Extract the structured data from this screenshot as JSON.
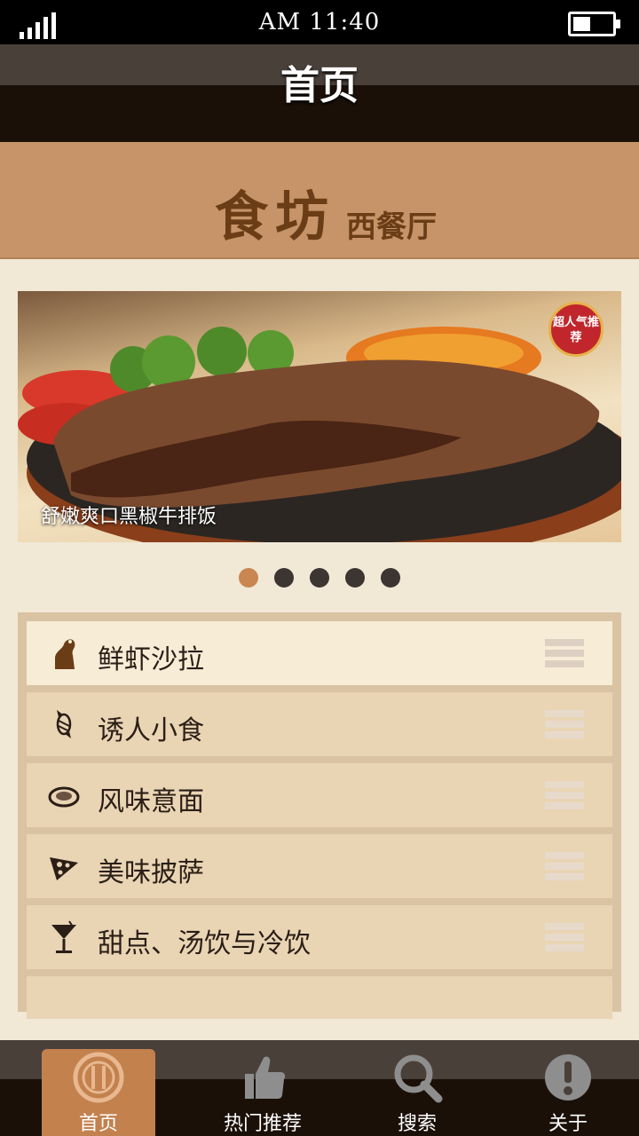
{
  "status_bar": {
    "time": "AM 11:40",
    "battery_level": 0.45,
    "icons": [
      "signal-icon",
      "battery-icon"
    ]
  },
  "nav": {
    "title": "首页"
  },
  "brand": {
    "name": "食坊",
    "subtitle": "西餐厅"
  },
  "banner": {
    "caption": "舒嫩爽口黑椒牛排饭",
    "badge": "超人气推荐",
    "slide_count": 5,
    "active_slide": 1
  },
  "menu": {
    "items": [
      {
        "label": "鲜虾沙拉",
        "icon": "shrimp-icon"
      },
      {
        "label": "诱人小食",
        "icon": "candy-icon"
      },
      {
        "label": "风味意面",
        "icon": "pasta-bowl-icon"
      },
      {
        "label": "美味披萨",
        "icon": "pizza-icon"
      },
      {
        "label": "甜点、汤饮与冷饮",
        "icon": "cocktail-icon"
      }
    ]
  },
  "tabs": [
    {
      "label": "首页",
      "icon": "home-utensils-icon"
    },
    {
      "label": "热门推荐",
      "icon": "thumbs-up-icon"
    },
    {
      "label": "搜索",
      "icon": "search-icon"
    },
    {
      "label": "关于",
      "icon": "info-icon"
    }
  ],
  "colors": {
    "brand_band": "#c69468",
    "accent": "#c3814e",
    "menu_bg": "#e9d4b4",
    "dark": "#1a1008"
  }
}
